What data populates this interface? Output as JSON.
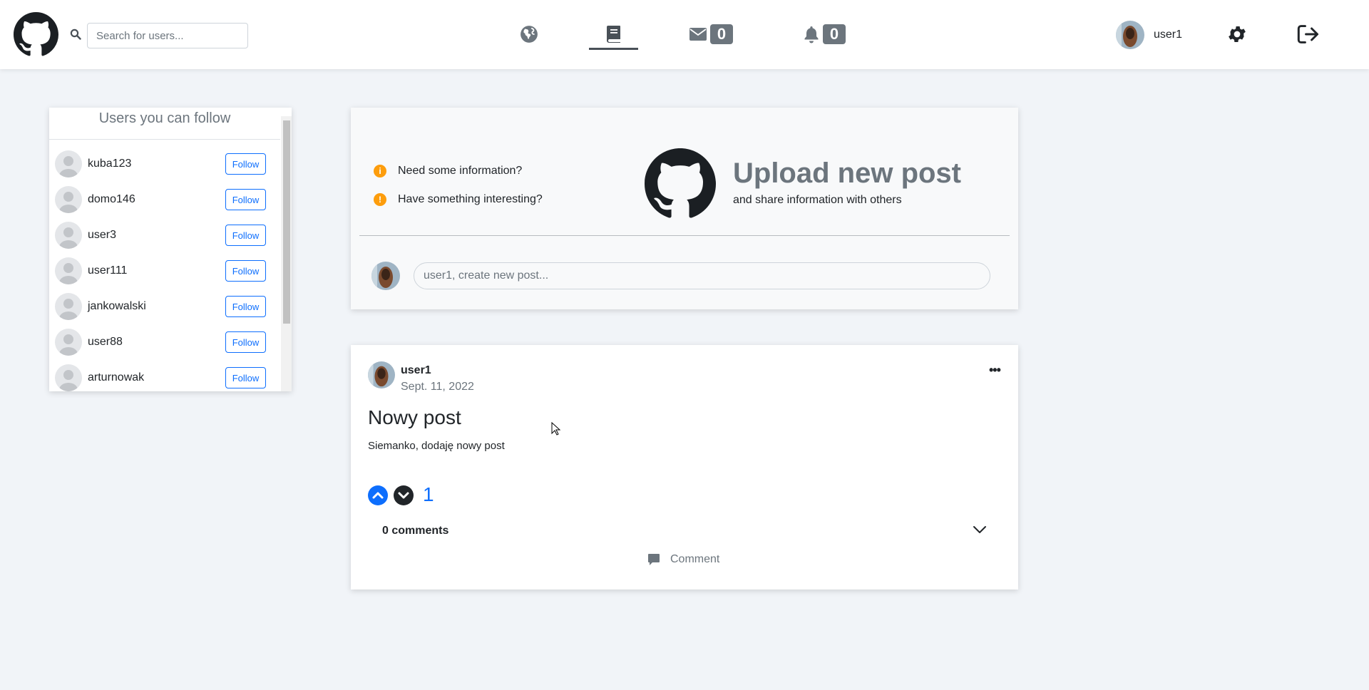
{
  "header": {
    "search": {
      "placeholder": "Search for users...",
      "value": ""
    },
    "messages_count": "0",
    "notifications_count": "0",
    "username": "user1"
  },
  "follow_panel": {
    "title": "Users you can follow",
    "follow_label": "Follow",
    "users": [
      {
        "name": "kuba123"
      },
      {
        "name": "domo146"
      },
      {
        "name": "user3"
      },
      {
        "name": "user111"
      },
      {
        "name": "jankowalski"
      },
      {
        "name": "user88"
      },
      {
        "name": "arturnowak"
      }
    ]
  },
  "upload": {
    "info_1": "Need some information?",
    "info_2": "Have something interesting?",
    "title": "Upload new post",
    "subtitle": "and share information with others",
    "input_placeholder": "user1, create new post..."
  },
  "post": {
    "author": "user1",
    "date": "Sept. 11, 2022",
    "menu": "•••",
    "title": "Nowy post",
    "body": "Siemanko, dodaję nowy post",
    "votes": "1",
    "comments_count": "0 comments",
    "comment_label": "Comment"
  },
  "colors": {
    "accent": "#0d6efd",
    "warning": "#fd9d0c",
    "background": "#f1f4f8",
    "muted": "#6c757d"
  }
}
